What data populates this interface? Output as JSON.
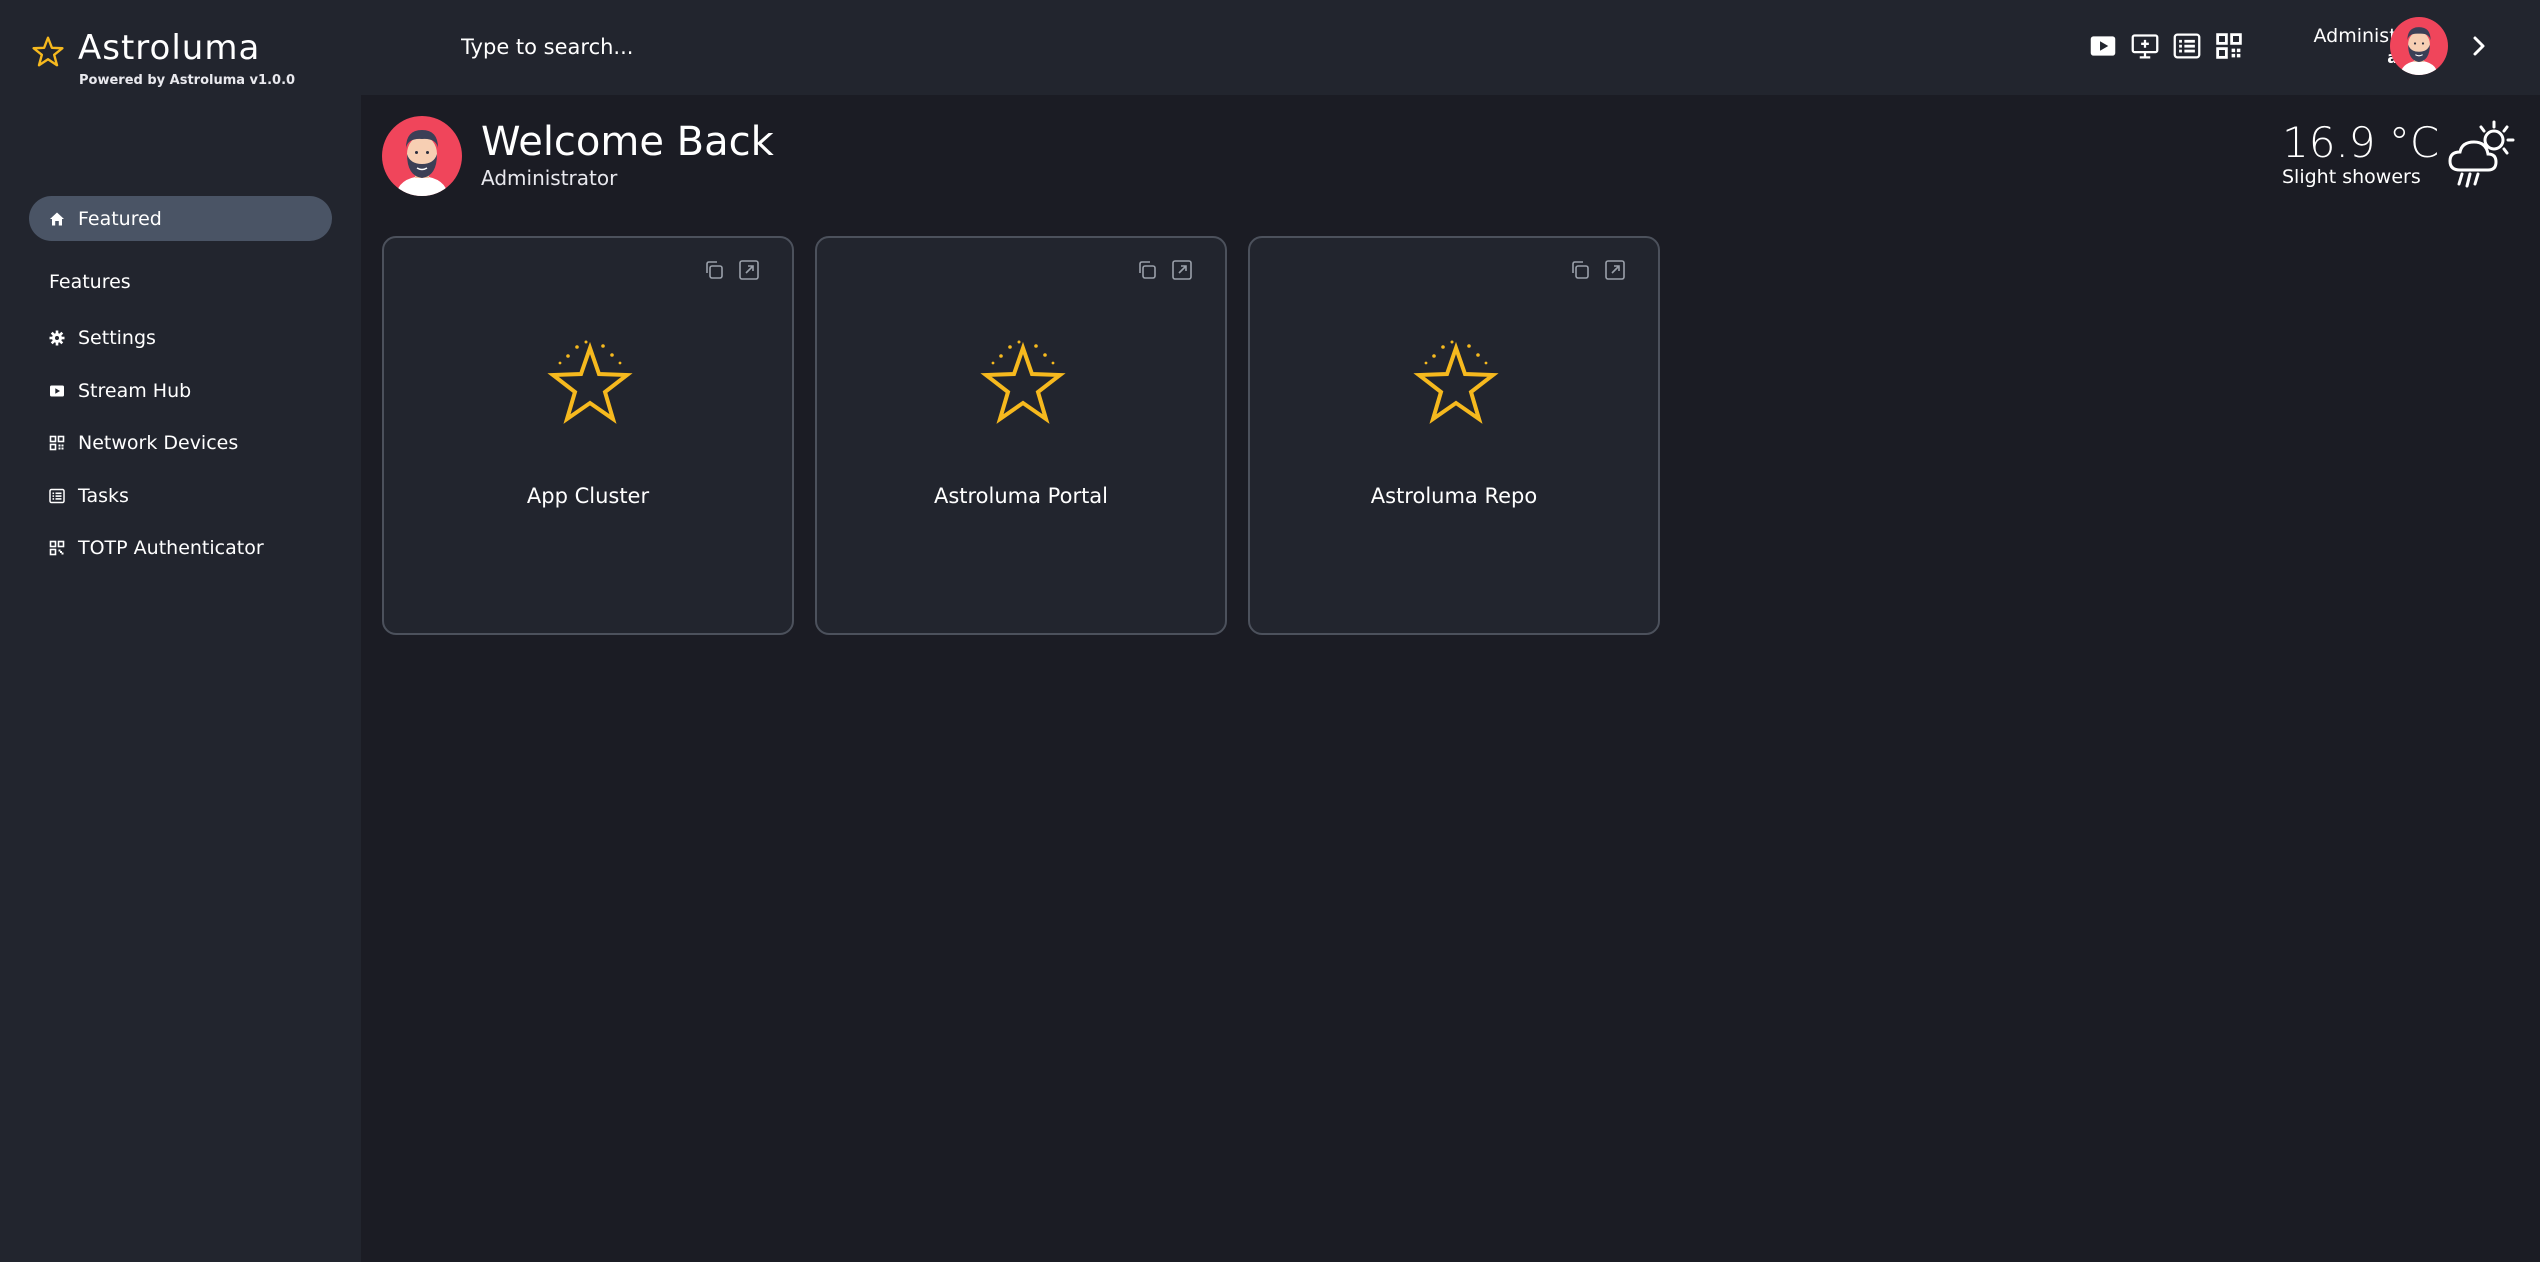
{
  "brand": {
    "name": "Astroluma",
    "powered_by": "Powered by Astroluma v1.0.0"
  },
  "colors": {
    "accent": "#f6b91e",
    "sidebar_bg": "#22252e",
    "main_bg": "#1b1c24",
    "nav_active_bg": "#4a5465",
    "card_border": "#4c515c"
  },
  "search": {
    "placeholder": "Type to search..."
  },
  "top_icons": [
    "video-play-icon",
    "monitor-plus-icon",
    "list-icon",
    "qr-code-icon"
  ],
  "user": {
    "name": "Administrator",
    "role": "admin"
  },
  "sidebar": {
    "active_item": {
      "label": "Featured",
      "icon": "home-icon"
    },
    "section_title": "Features",
    "items": [
      {
        "label": "Settings",
        "icon": "gear-icon"
      },
      {
        "label": "Stream Hub",
        "icon": "video-play-icon"
      },
      {
        "label": "Network Devices",
        "icon": "grid-icon"
      },
      {
        "label": "Tasks",
        "icon": "list-icon"
      },
      {
        "label": "TOTP Authenticator",
        "icon": "qr-code-icon"
      }
    ]
  },
  "welcome": {
    "title": "Welcome Back",
    "subtitle": "Administrator"
  },
  "weather": {
    "temperature": "16.9 °C",
    "description": "Slight showers",
    "icon": "cloud-rain-sun-icon"
  },
  "cards": [
    {
      "title": "App Cluster",
      "icon": "star-icon"
    },
    {
      "title": "Astroluma Portal",
      "icon": "star-icon"
    },
    {
      "title": "Astroluma Repo",
      "icon": "star-icon"
    }
  ]
}
